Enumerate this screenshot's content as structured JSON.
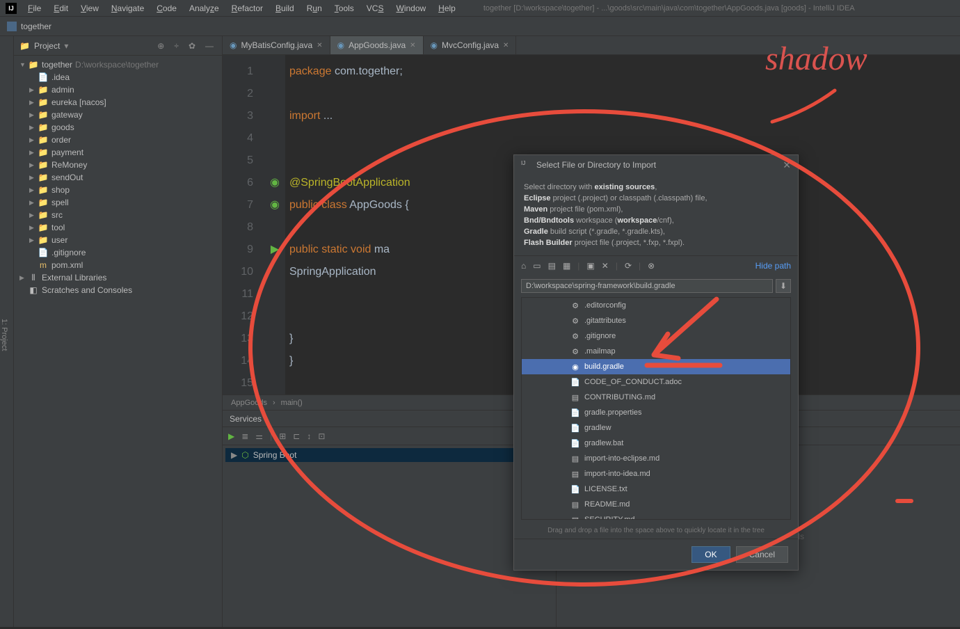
{
  "menu": [
    "File",
    "Edit",
    "View",
    "Navigate",
    "Code",
    "Analyze",
    "Refactor",
    "Build",
    "Run",
    "Tools",
    "VCS",
    "Window",
    "Help"
  ],
  "window_title": "together [D:\\workspace\\together] - ...\\goods\\src\\main\\java\\com\\together\\AppGoods.java [goods] - IntelliJ IDEA",
  "nav_project": "together",
  "sidebar_label": "Project",
  "left_gutter": "1: Project",
  "tree": {
    "root": "together",
    "root_hint": "D:\\workspace\\together",
    "items": [
      ".idea",
      "admin",
      "eureka [nacos]",
      "gateway",
      "goods",
      "order",
      "payment",
      "ReMoney",
      "sendOut",
      "shop",
      "spell",
      "src",
      "tool",
      "user",
      ".gitignore",
      "pom.xml"
    ],
    "ext1": "External Libraries",
    "ext2": "Scratches and Consoles"
  },
  "tabs": [
    {
      "name": "MyBatisConfig.java",
      "active": false
    },
    {
      "name": "AppGoods.java",
      "active": true
    },
    {
      "name": "MvcConfig.java",
      "active": false
    }
  ],
  "code_lines": [
    "1",
    "2",
    "3",
    "4",
    "5",
    "6",
    "7",
    "8",
    "9",
    "10",
    "11",
    "12",
    "13",
    "14",
    "15"
  ],
  "code": {
    "l1a": "package ",
    "l1b": "com.together;",
    "l3a": "import ",
    "l3b": "...",
    "l6": "@SpringBootApplication",
    "l7a": "public class ",
    "l7b": "AppGoods {",
    "l9a": "    public static void ",
    "l9b": "ma",
    "l10": "        SpringApplication",
    "l13": "    }",
    "l14": "}"
  },
  "breadcrumb": [
    "AppGoods",
    "main()"
  ],
  "services": {
    "title": "Services",
    "item": "Spring Boot",
    "hint": "...e in tree to view details"
  },
  "dialog": {
    "title": "Select File or Directory to Import",
    "desc_l1": "Select directory with ",
    "desc_l1b": "existing sources",
    "desc_l1c": ",",
    "desc_l2a": "Eclipse",
    "desc_l2b": " project (.project) or classpath (.classpath) file,",
    "desc_l3a": "Maven",
    "desc_l3b": " project file (pom.xml),",
    "desc_l4a": "Bnd/Bndtools",
    "desc_l4b": " workspace (",
    "desc_l4c": "workspace",
    "desc_l4d": "/cnf),",
    "desc_l5a": "Gradle",
    "desc_l5b": " build script (*.gradle, *.gradle.kts),",
    "desc_l6a": "Flash Builder",
    "desc_l6b": " project file (.project, *.fxp, *.fxpl).",
    "hide": "Hide path",
    "path": "D:\\workspace\\spring-framework\\build.gradle",
    "files": [
      ".editorconfig",
      ".gitattributes",
      ".gitignore",
      ".mailmap",
      "build.gradle",
      "CODE_OF_CONDUCT.adoc",
      "CONTRIBUTING.md",
      "gradle.properties",
      "gradlew",
      "gradlew.bat",
      "import-into-eclipse.md",
      "import-into-idea.md",
      "LICENSE.txt",
      "README.md",
      "SECURITY.md"
    ],
    "selected": "build.gradle",
    "drop_hint": "Drag and drop a file into the space above to quickly locate it in the tree",
    "ok": "OK",
    "cancel": "Cancel"
  },
  "annotation": "shadow"
}
